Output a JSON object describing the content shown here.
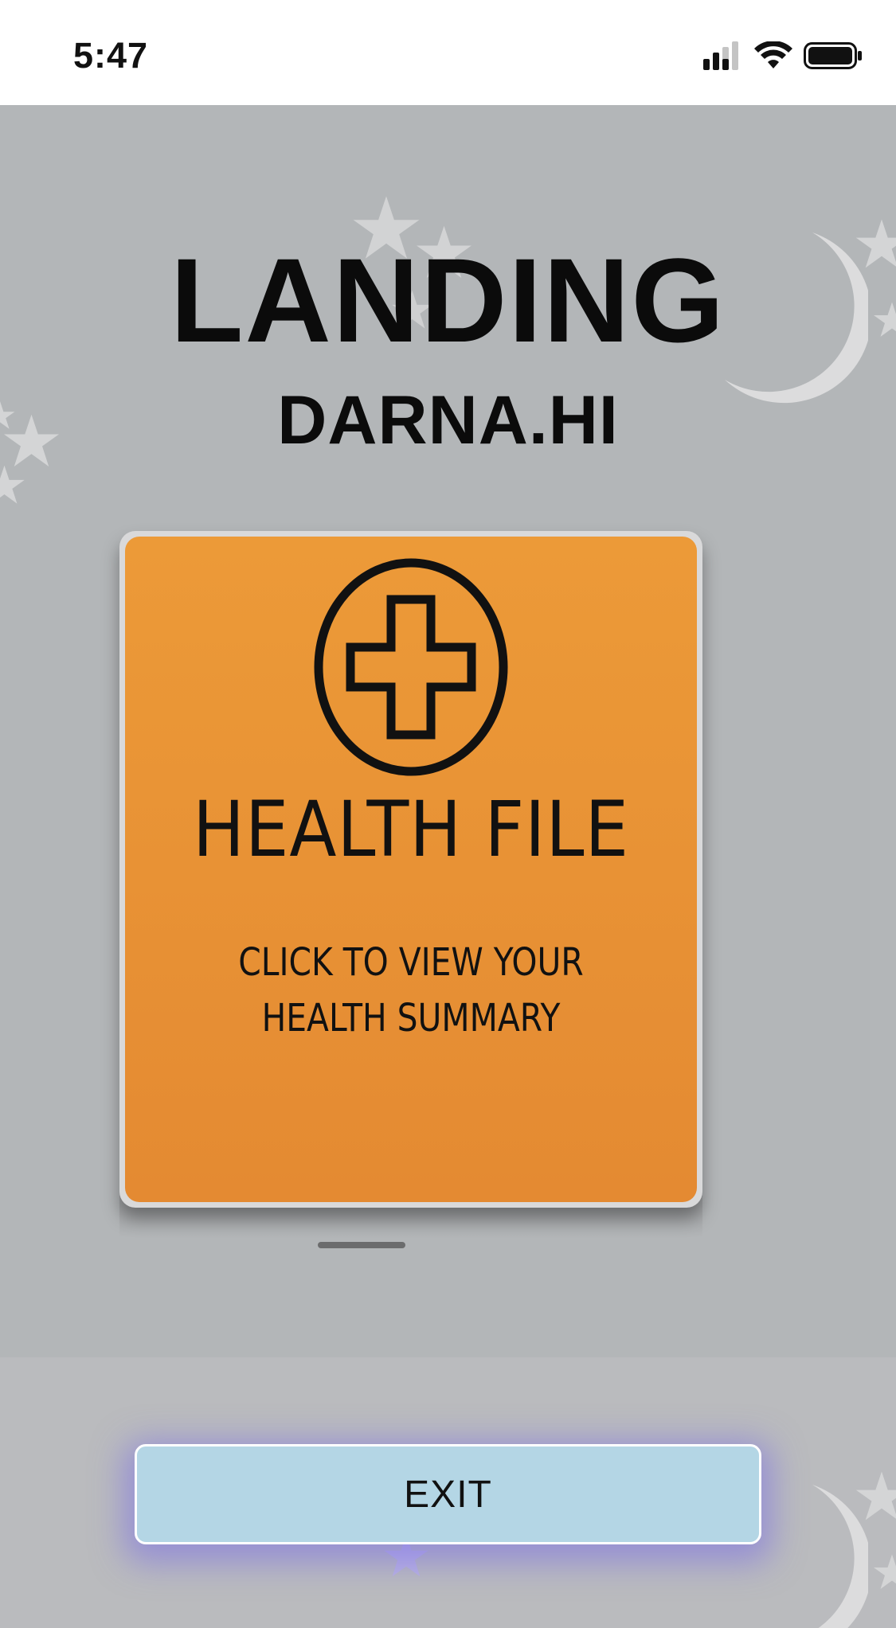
{
  "status_bar": {
    "time": "5:47",
    "icons": [
      "cellular-signal-icon",
      "wifi-icon",
      "battery-icon"
    ]
  },
  "header": {
    "title": "LANDING",
    "subtitle": "DARNA.HI"
  },
  "health_card": {
    "icon": "medical-cross-icon",
    "title": "HEALTH FILE",
    "caption_line1": "CLICK TO VIEW YOUR",
    "caption_line2": "HEALTH SUMMARY"
  },
  "pager": {
    "pages": 1,
    "current": 1
  },
  "footer": {
    "exit_label": "EXIT"
  },
  "colors": {
    "background": "#b3b6b8",
    "card": "#ec9a38",
    "exit_button": "#b4d6e5",
    "exit_glow": "#7a6ee6"
  }
}
